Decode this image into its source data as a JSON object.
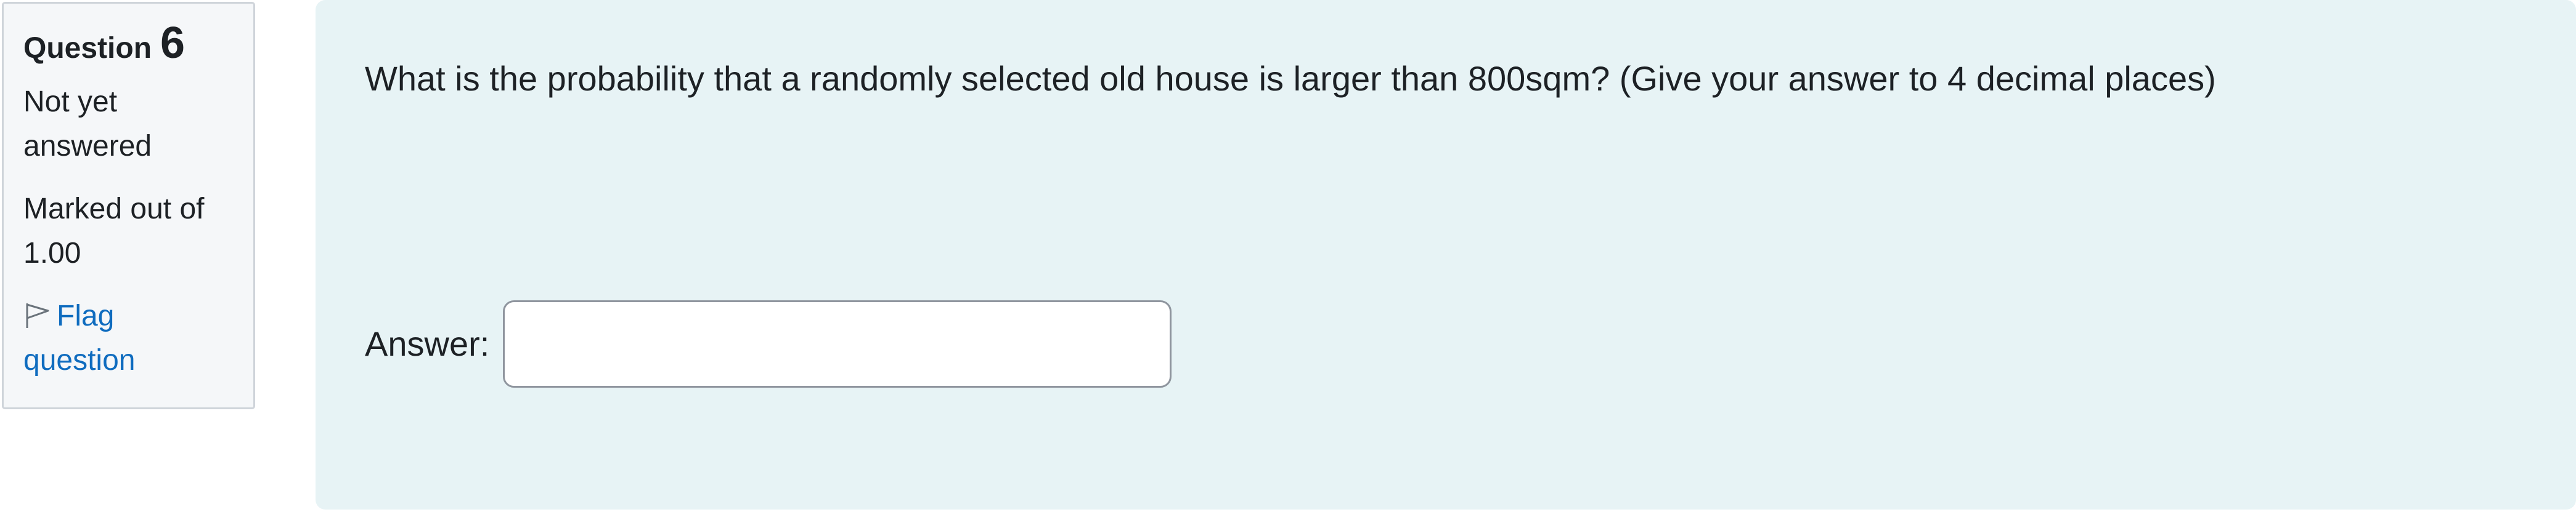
{
  "question": {
    "label": "Question",
    "number": "6",
    "state": "Not yet answered",
    "grade": "Marked out of 1.00",
    "flag_label": "Flag question",
    "flag_icon": "flag-outline-icon",
    "text": "What is the probability that a randomly selected old house is larger than 800sqm? (Give your answer to 4 decimal places)"
  },
  "answer": {
    "label": "Answer:",
    "value": "",
    "placeholder": ""
  },
  "colors": {
    "info_bg": "#f5f7f9",
    "content_bg": "#e7f3f5",
    "link": "#0f6cbf"
  }
}
